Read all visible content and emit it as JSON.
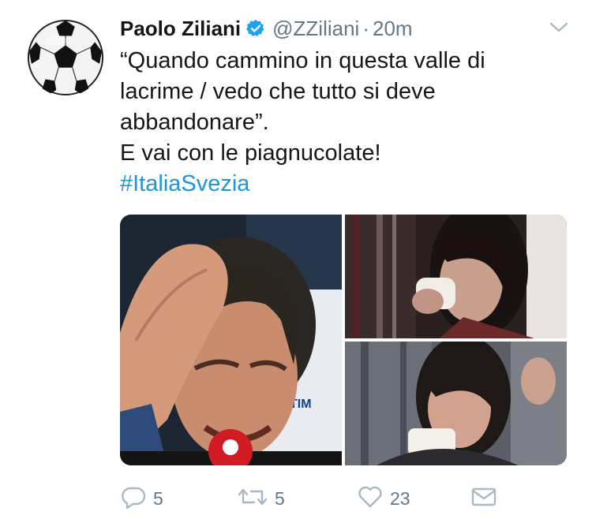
{
  "tweet": {
    "author_name": "Paolo Ziliani",
    "handle": "@ZZiliani",
    "separator": "·",
    "time": "20m",
    "text_lines": [
      "“Quando cammino in questa valle di",
      "lacrime / vedo che tutto si deve",
      "abbandonare”.",
      "E vai con le piagnucolate!"
    ],
    "hashtag": "#ItaliaSvezia",
    "media": {
      "left_image": {
        "sponsor_text": "TIM"
      },
      "top_right_image": {},
      "bottom_right_image": {}
    },
    "actions": {
      "reply_count": "5",
      "retweet_count": "5",
      "like_count": "23"
    }
  },
  "icons": {
    "avatar": "soccer-ball",
    "verified": "verified-badge-icon",
    "caret": "chevron-down-icon",
    "reply": "reply-icon",
    "retweet": "retweet-icon",
    "like": "heart-icon",
    "dm": "envelope-icon"
  },
  "colors": {
    "text": "#14171a",
    "secondary": "#657786",
    "link": "#1b95e0",
    "verified": "#1da1f2",
    "icon_gray": "#aab8c2"
  }
}
